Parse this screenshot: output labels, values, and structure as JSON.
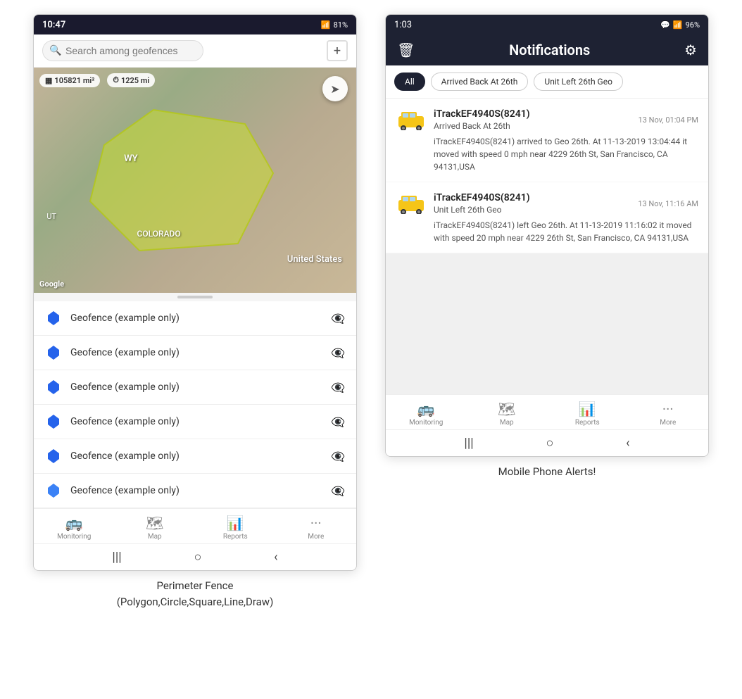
{
  "left_screen": {
    "status_bar": {
      "time": "10:47",
      "signal": "WiFi+4G",
      "battery": "81%"
    },
    "search_placeholder": "Search among geofences",
    "map": {
      "stat1": "105821 mi²",
      "stat2": "1225 mi",
      "state_wy": "WY",
      "state_ut": "UT",
      "state_co": "COLORADO",
      "country": "United States",
      "google_label": "Google"
    },
    "geofence_items": [
      {
        "name": "Geofence (example only)"
      },
      {
        "name": "Geofence (example only)"
      },
      {
        "name": "Geofence (example only)"
      },
      {
        "name": "Geofence (example only)"
      },
      {
        "name": "Geofence (example only)"
      },
      {
        "name": "Geofence (example only)"
      }
    ],
    "bottom_nav": [
      {
        "icon": "🚌",
        "label": "Monitoring"
      },
      {
        "icon": "🗺",
        "label": "Map"
      },
      {
        "icon": "📊",
        "label": "Reports"
      },
      {
        "icon": "···",
        "label": "More"
      }
    ],
    "caption": "Perimeter Fence\n(Polygon,Circle,Square,Line,Draw)"
  },
  "right_screen": {
    "status_bar": {
      "time": "1:03",
      "battery": "96%"
    },
    "header": {
      "title": "Notifications",
      "left_icon": "trash",
      "right_icon": "settings"
    },
    "filters": [
      {
        "label": "All",
        "active": true
      },
      {
        "label": "Arrived Back At 26th",
        "active": false
      },
      {
        "label": "Unit Left 26th Geo",
        "active": false
      }
    ],
    "notifications": [
      {
        "device": "iTrackEF4940S(8241)",
        "event": "Arrived Back At 26th",
        "timestamp": "13 Nov, 01:04 PM",
        "body": "iTrackEF4940S(8241) arrived to Geo 26th.    At 11-13-2019 13:04:44 it moved with speed 0 mph near 4229 26th St, San Francisco, CA 94131,USA"
      },
      {
        "device": "iTrackEF4940S(8241)",
        "event": "Unit Left 26th Geo",
        "timestamp": "13 Nov, 11:16 AM",
        "body": "iTrackEF4940S(8241) left Geo 26th.    At 11-13-2019 11:16:02 it moved with speed 20 mph near 4229 26th St, San Francisco, CA 94131,USA"
      }
    ],
    "bottom_nav": [
      {
        "icon": "🚌",
        "label": "Monitoring"
      },
      {
        "icon": "🗺",
        "label": "Map"
      },
      {
        "icon": "📊",
        "label": "Reports"
      },
      {
        "icon": "···",
        "label": "More"
      }
    ],
    "caption": "Mobile Phone Alerts!"
  }
}
